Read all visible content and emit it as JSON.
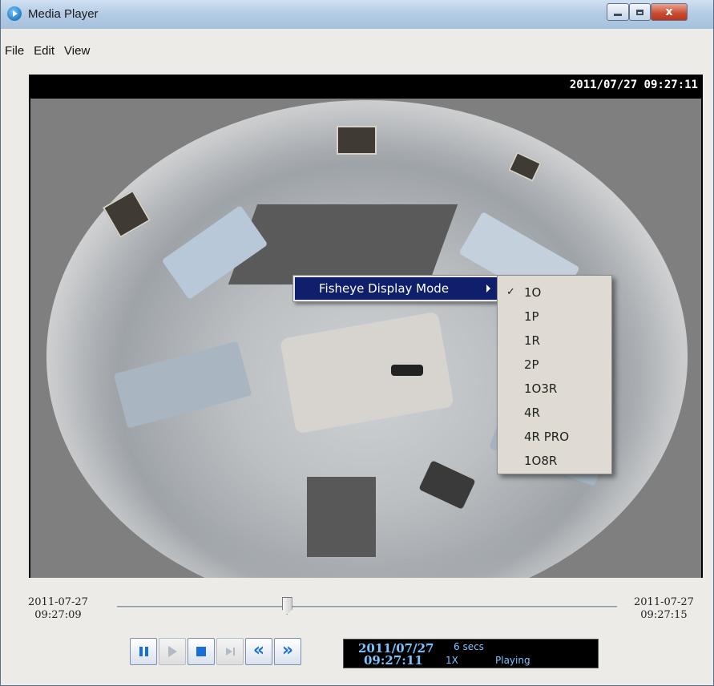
{
  "window": {
    "title": "Media Player",
    "app_icon": "play-circle-icon",
    "close_label": "x"
  },
  "menubar": {
    "items": [
      "File",
      "Edit",
      "View"
    ]
  },
  "video": {
    "osd_timestamp": "2011/07/27 09:27:11"
  },
  "context_menu": {
    "item_label": "Fisheye Display Mode",
    "submenu": [
      {
        "label": "1O",
        "checked": true
      },
      {
        "label": "1P",
        "checked": false
      },
      {
        "label": "1R",
        "checked": false
      },
      {
        "label": "2P",
        "checked": false
      },
      {
        "label": "1O3R",
        "checked": false
      },
      {
        "label": "4R",
        "checked": false
      },
      {
        "label": "4R PRO",
        "checked": false
      },
      {
        "label": "1O8R",
        "checked": false
      }
    ],
    "check_glyph": "✓"
  },
  "timeline": {
    "start_date": "2011-07-27",
    "start_time": "09:27:09",
    "end_date": "2011-07-27",
    "end_time": "09:27:15",
    "position_fraction": 0.34
  },
  "controls": {
    "buttons": [
      "pause",
      "play",
      "stop",
      "step-forward",
      "rewind",
      "fast-forward"
    ]
  },
  "status": {
    "date": "2011/07/27",
    "time": "09:27:11",
    "secs": "6 secs",
    "speed": "1X",
    "state": "Playing"
  },
  "colors": {
    "highlight": "#0f1f6b",
    "status_text": "#7cc4ff",
    "accent_blue": "#1a6fd6"
  }
}
